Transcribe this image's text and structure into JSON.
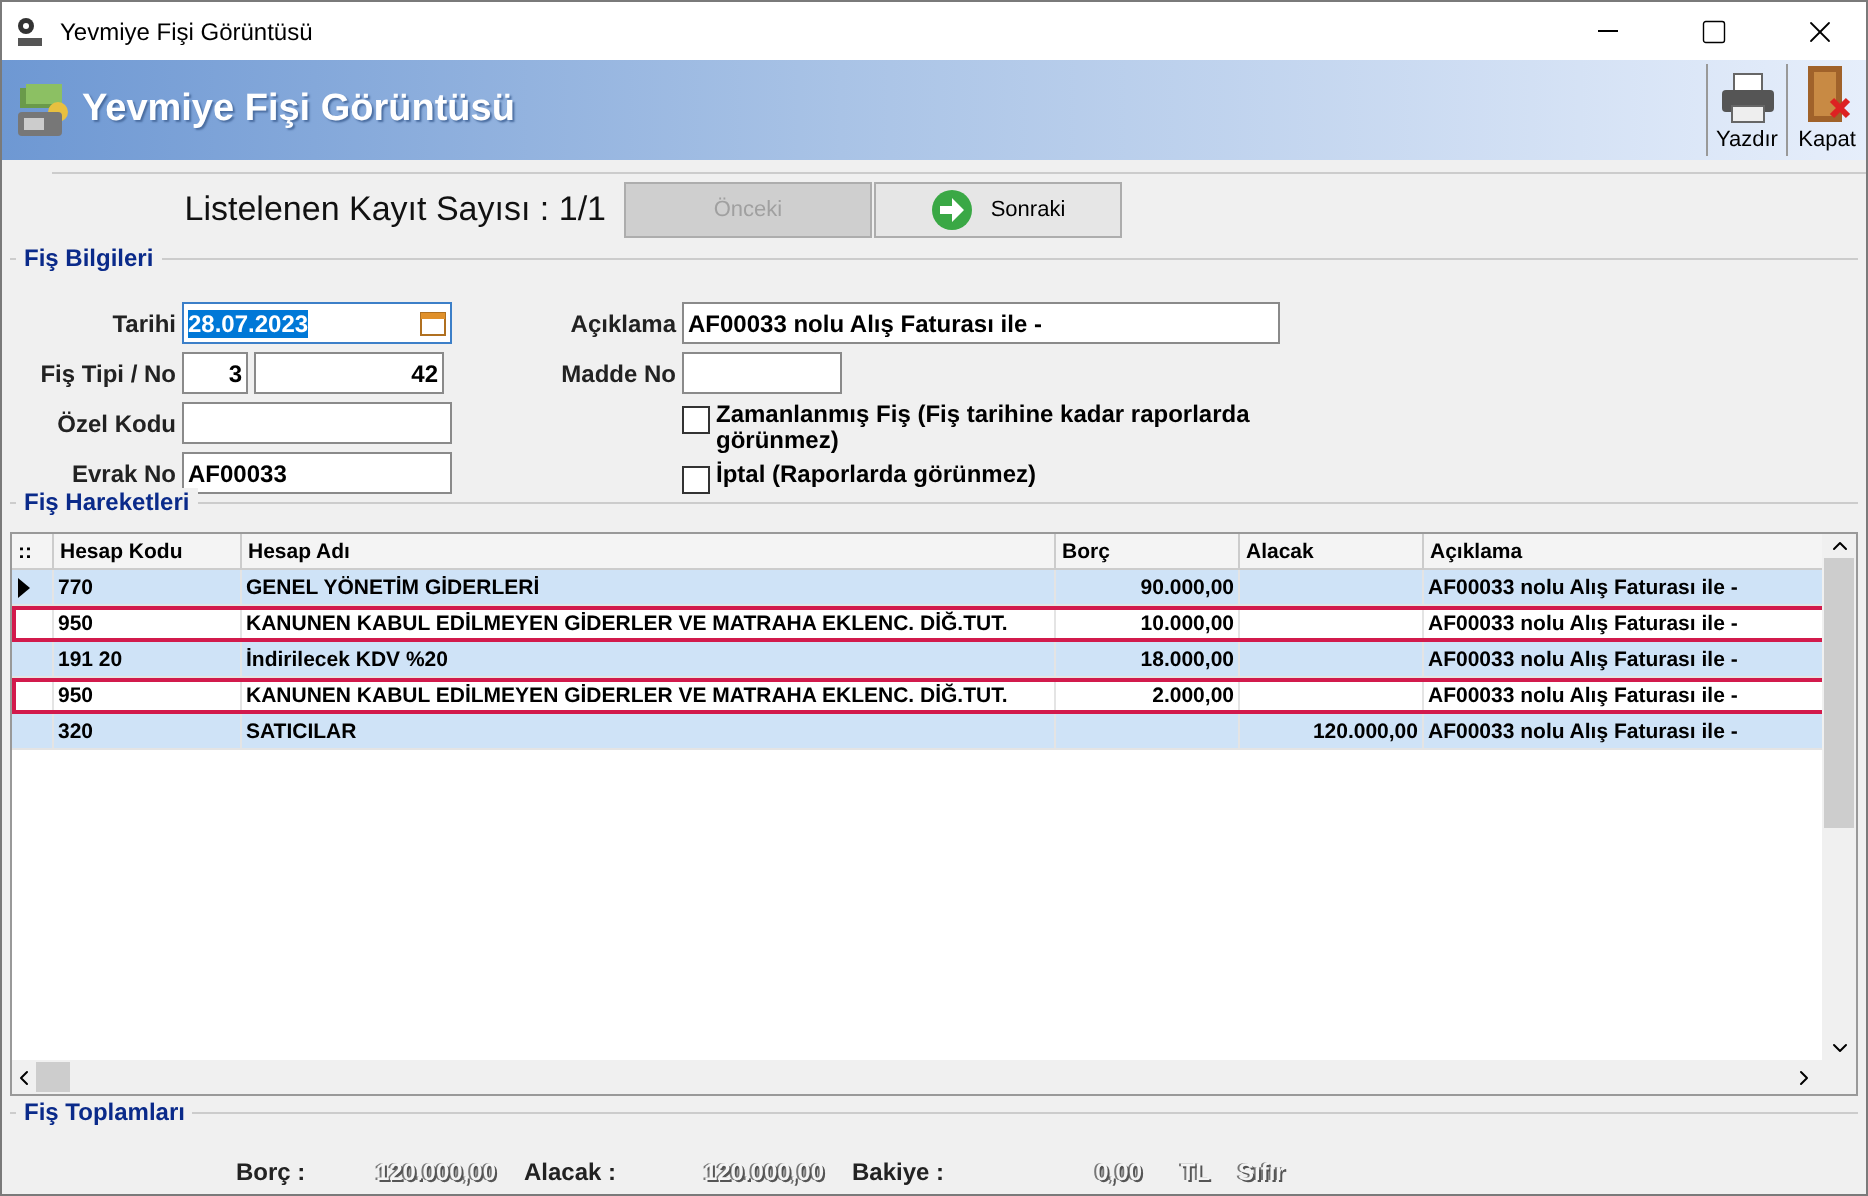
{
  "window": {
    "title": "Yevmiye Fişi Görüntüsü"
  },
  "header": {
    "title": "Yevmiye Fişi Görüntüsü",
    "actions": [
      {
        "label": "Yazdır",
        "kind": "print"
      },
      {
        "label": "Kapat",
        "kind": "close"
      }
    ]
  },
  "nav": {
    "record_count": "Listelenen Kayıt Sayısı : 1/1",
    "buttons": [
      {
        "label": "Önceki",
        "kind": "prev",
        "disabled": true
      },
      {
        "label": "Sonraki",
        "kind": "next",
        "disabled": false
      }
    ]
  },
  "fis_bilgileri": {
    "title": "Fiş Bilgileri",
    "tarihi": {
      "label": "Tarihi",
      "value": "28.07.2023",
      "selected": true
    },
    "fis_tipi_no": {
      "label": "Fiş Tipi / No",
      "tipi": "3",
      "no": "42"
    },
    "ozel_kodu": {
      "label": "Özel Kodu"
    },
    "evrak_no": {
      "label": "Evrak No",
      "value": "AF00033"
    },
    "aciklama": {
      "label": "Açıklama",
      "value": "AF00033 nolu Alış Faturası ile -"
    },
    "madde_no": {
      "label": "Madde No"
    },
    "checkboxes": [
      {
        "label": "Zamanlanmış Fiş (Fiş tarihine kadar raporlarda görünmez)",
        "checked": false
      },
      {
        "label": "İptal (Raporlarda görünmez)",
        "checked": false
      }
    ]
  },
  "fis_hareketleri": {
    "title": "Fiş Hareketleri",
    "columns": [
      "::",
      "Hesap Kodu",
      "Hesap Adı",
      "Borç",
      "Alacak",
      "Açıklama"
    ],
    "rows": [
      {
        "current": true,
        "highlighted": false,
        "cells": [
          "",
          "770",
          "GENEL YÖNETİM GİDERLERİ",
          "90.000,00",
          "",
          "AF00033 nolu Alış Faturası ile -"
        ]
      },
      {
        "current": false,
        "highlighted": true,
        "cells": [
          "",
          "950",
          "KANUNEN KABUL EDİLMEYEN GİDERLER VE MATRAHA EKLENC. DİĞ.TUT.",
          "10.000,00",
          "",
          "AF00033 nolu Alış Faturası ile -"
        ]
      },
      {
        "current": false,
        "highlighted": false,
        "cells": [
          "",
          "191 20",
          "İndirilecek KDV %20",
          "18.000,00",
          "",
          "AF00033 nolu Alış Faturası ile -"
        ]
      },
      {
        "current": false,
        "highlighted": true,
        "cells": [
          "",
          "950",
          "KANUNEN KABUL EDİLMEYEN GİDERLER VE MATRAHA EKLENC. DİĞ.TUT.",
          "2.000,00",
          "",
          "AF00033 nolu Alış Faturası ile -"
        ]
      },
      {
        "current": false,
        "highlighted": false,
        "cells": [
          "",
          "320",
          "SATICILAR",
          "",
          "120.000,00",
          "AF00033 nolu Alış Faturası ile -"
        ]
      }
    ]
  },
  "fis_toplamlari": {
    "title": "Fiş Toplamları",
    "items": [
      {
        "label": "Borç :",
        "value": "120.000,00"
      },
      {
        "label": "Alacak :",
        "value": "120.000,00"
      },
      {
        "label": "Bakiye :",
        "value": "0,00"
      }
    ],
    "currency": "TL",
    "status": "Sıfır"
  }
}
